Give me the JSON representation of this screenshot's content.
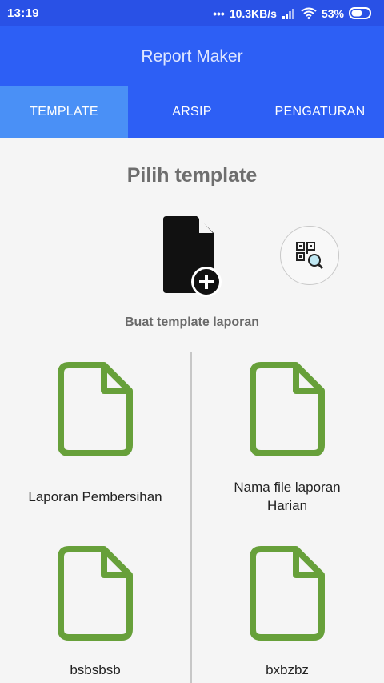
{
  "status": {
    "time": "13:19",
    "speed": "10.3KB/s",
    "battery": "53%"
  },
  "app": {
    "title": "Report Maker"
  },
  "tabs": [
    {
      "label": "TEMPLATE"
    },
    {
      "label": "ARSIP"
    },
    {
      "label": "PENGATURAN"
    }
  ],
  "main": {
    "heading": "Pilih template",
    "new_template_label": "Buat template laporan"
  },
  "templates": [
    {
      "label": "Laporan Pembersihan"
    },
    {
      "label": "Nama file laporan Harian"
    },
    {
      "label": "bsbsbsb"
    },
    {
      "label": "bxbzbz"
    }
  ],
  "colors": {
    "status_bar": "#2951e6",
    "app_bar": "#2d5ff5",
    "active_tab": "#4a90f6",
    "template_icon": "#67a03a"
  }
}
